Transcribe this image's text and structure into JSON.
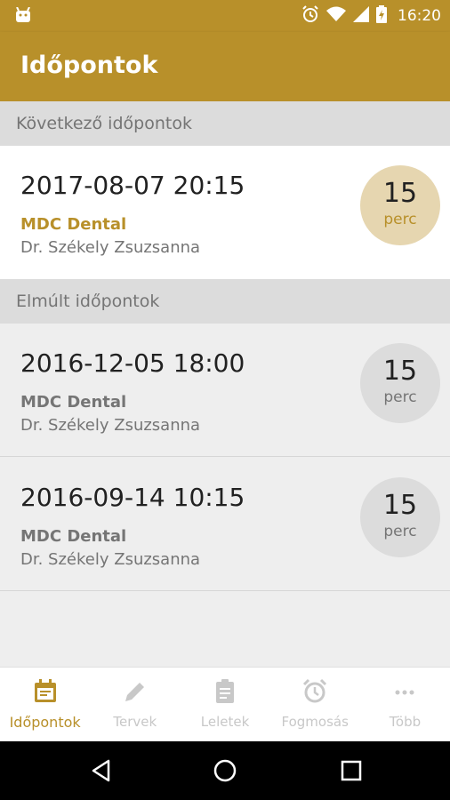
{
  "status_bar": {
    "time": "16:20"
  },
  "app_bar": {
    "title": "Időpontok"
  },
  "sections": {
    "upcoming_title": "Következő időpontok",
    "past_title": "Elmúlt időpontok"
  },
  "upcoming": [
    {
      "date": "2017-08-07 20:15",
      "clinic": "MDC Dental",
      "doctor": "Dr. Székely Zsuzsanna",
      "duration": "15",
      "unit": "perc"
    }
  ],
  "past": [
    {
      "date": "2016-12-05 18:00",
      "clinic": "MDC Dental",
      "doctor": "Dr. Székely Zsuzsanna",
      "duration": "15",
      "unit": "perc"
    },
    {
      "date": "2016-09-14 10:15",
      "clinic": "MDC Dental",
      "doctor": "Dr. Székely Zsuzsanna",
      "duration": "15",
      "unit": "perc"
    }
  ],
  "bottom_nav": {
    "items": [
      {
        "label": "Időpontok",
        "icon": "calendar-icon",
        "active": true
      },
      {
        "label": "Tervek",
        "icon": "pencil-icon",
        "active": false
      },
      {
        "label": "Leletek",
        "icon": "clipboard-icon",
        "active": false
      },
      {
        "label": "Fogmosás",
        "icon": "alarm-clock-icon",
        "active": false
      },
      {
        "label": "Több",
        "icon": "more-dots-icon",
        "active": false
      }
    ]
  },
  "colors": {
    "primary": "#b8902a",
    "primary_light": "#e6d6b0",
    "inactive": "#c8c8c8"
  }
}
